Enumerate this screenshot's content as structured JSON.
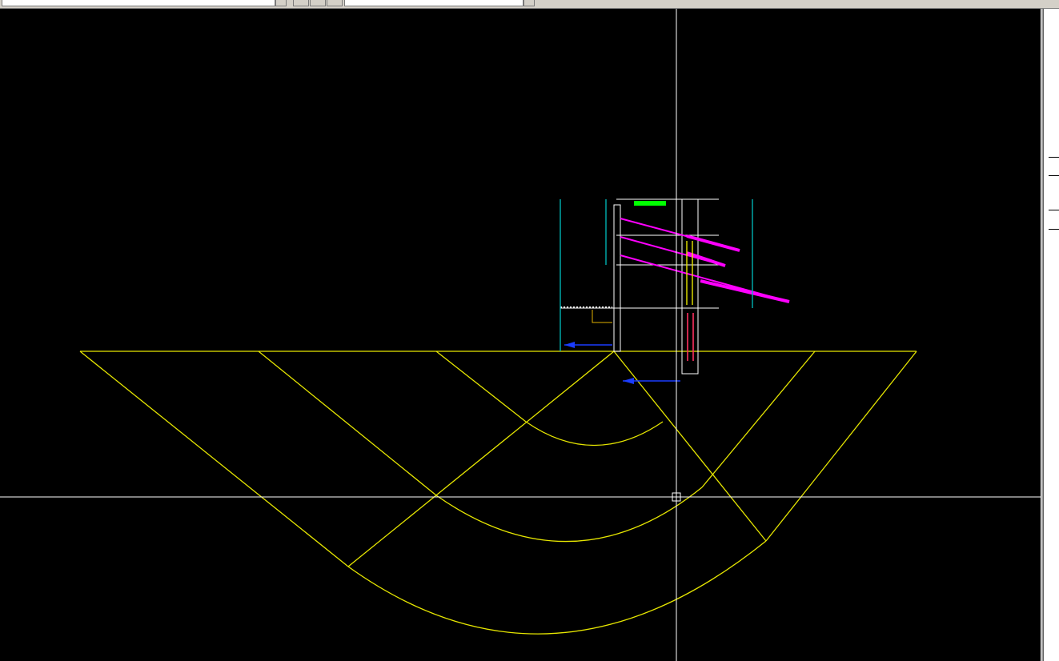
{
  "toolbar": {
    "item_combo_value": "",
    "buttons": [
      {
        "name": "button-1",
        "label": ""
      },
      {
        "name": "button-2",
        "label": ""
      },
      {
        "name": "button-3",
        "label": ""
      }
    ],
    "view_combo_value": ""
  },
  "drawing": {
    "section_title": "",
    "dims_left": [
      "",
      ""
    ],
    "dims_left_small": [
      "",
      "",
      ""
    ],
    "dims_right": [
      "",
      ""
    ],
    "wall_labels": [
      "",
      "",
      ""
    ]
  },
  "side_panel": {
    "row1": "",
    "row2": "",
    "row3": "",
    "row4": ""
  },
  "colors": {
    "canvas_bg": "#000000",
    "slip_lines": "#e6e600",
    "anchors": "#ff00ff",
    "dimensions": "#00c0c0",
    "water_level": "#1a3cff",
    "crosshair": "#ffffff",
    "grass": "#00ff00"
  }
}
